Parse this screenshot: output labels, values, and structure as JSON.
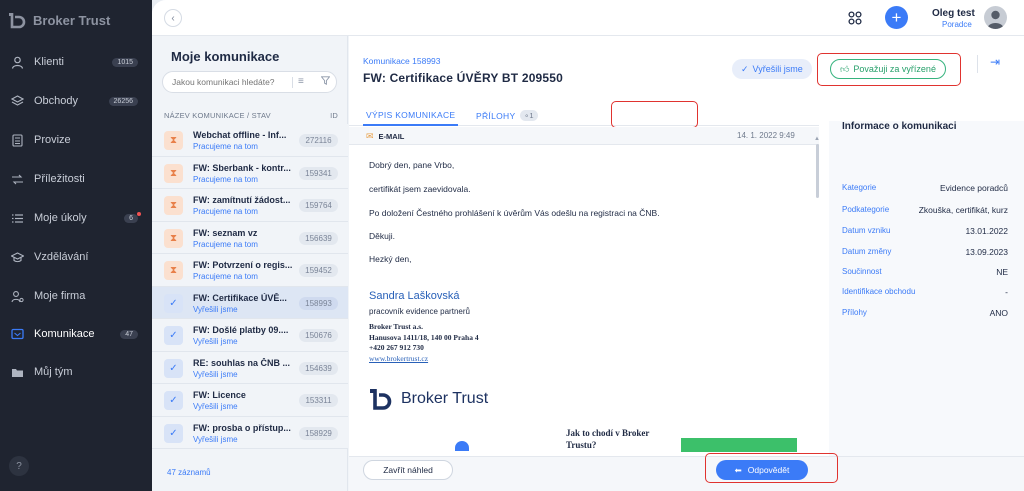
{
  "app": {
    "name": "Broker Trust"
  },
  "sidebar": {
    "items": [
      {
        "label": "Klienti",
        "badge": "1015",
        "icon": "person-icon"
      },
      {
        "label": "Obchody",
        "badge": "26256",
        "icon": "layers-icon"
      },
      {
        "label": "Provize",
        "badge": "",
        "icon": "calculator-icon"
      },
      {
        "label": "Příležitosti",
        "badge": "",
        "icon": "opportunity-icon"
      },
      {
        "label": "Moje úkoly",
        "badge": "6",
        "icon": "list-icon"
      },
      {
        "label": "Vzdělávání",
        "badge": "",
        "icon": "graduation-icon"
      },
      {
        "label": "Moje firma",
        "badge": "",
        "icon": "company-icon"
      },
      {
        "label": "Komunikace",
        "badge": "47",
        "icon": "chat-icon",
        "active": true
      },
      {
        "label": "Můj tým",
        "badge": "",
        "icon": "folder-icon"
      }
    ],
    "help_label": "?"
  },
  "topbar": {
    "user_name": "Oleg test",
    "user_role": "Poradce",
    "plus_label": "+"
  },
  "list": {
    "title": "Moje komunikace",
    "search_placeholder": "Jakou komunikaci hledáte?",
    "col_name": "NÁZEV KOMUNIKACE / STAV",
    "col_id": "ID",
    "rows": [
      {
        "title": "Webchat offline - Inf...",
        "status": "Pracujeme na tom",
        "id": "272116",
        "state": "pending"
      },
      {
        "title": "FW: Sberbank - kontr...",
        "status": "Pracujeme na tom",
        "id": "159341",
        "state": "pending"
      },
      {
        "title": "FW: zamítnutí žádost...",
        "status": "Pracujeme na tom",
        "id": "159764",
        "state": "pending"
      },
      {
        "title": "FW: seznam vz",
        "status": "Pracujeme na tom",
        "id": "156639",
        "state": "pending"
      },
      {
        "title": "FW: Potvrzení o regis...",
        "status": "Pracujeme na tom",
        "id": "159452",
        "state": "pending"
      },
      {
        "title": "FW: Certifikace ÚVĚ...",
        "status": "Vyřešili jsme",
        "id": "158993",
        "state": "done",
        "selected": true
      },
      {
        "title": "FW: Došlé platby 09....",
        "status": "Vyřešili jsme",
        "id": "150676",
        "state": "done"
      },
      {
        "title": "RE: souhlas na ČNB ...",
        "status": "Vyřešili jsme",
        "id": "154639",
        "state": "done"
      },
      {
        "title": "FW: Licence",
        "status": "Vyřešili jsme",
        "id": "153311",
        "state": "done"
      },
      {
        "title": "FW: prosba o přístup...",
        "status": "Vyřešili jsme",
        "id": "158929",
        "state": "done"
      }
    ],
    "count_label": "47 záznamů"
  },
  "detail": {
    "subtitle": "Komunikace 158993",
    "title": "FW: Certifikace ÚVĚRY BT 209550",
    "btn_resolved": "Vyřešili jsme",
    "btn_consider": "Považuji za vyřízené",
    "tabs": [
      {
        "label": "VÝPIS KOMUNIKACE"
      },
      {
        "label": "PŘÍLOHY",
        "count": "1"
      }
    ],
    "email": {
      "label": "E-MAIL",
      "date": "14. 1. 2022 9:49",
      "lines": [
        "Dobrý den, pane Vrbo,",
        "certifikát jsem zaevidovala.",
        "Po doložení Čestného prohlášení k úvěrům Vás odešlu na registraci na ČNB.",
        "Děkuji.",
        "Hezký den,"
      ],
      "sig_name": "Sandra Laškovská",
      "sig_role": "pracovník evidence partnerů",
      "sig_company": "Broker Trust a.s.",
      "sig_address": "Hanusova 1411/18, 140 00 Praha 4",
      "sig_phone": "+420 267 912 730",
      "sig_url": "www.brokertrust.cz",
      "logo_text": "Broker Trust",
      "promo_title": "Jak to chodí v Broker Trustu?"
    },
    "info": {
      "title": "Informace o komunikaci",
      "rows": [
        {
          "k": "Kategorie",
          "v": "Evidence poradců"
        },
        {
          "k": "Podkategorie",
          "v": "Zkouška, certifikát, kurz"
        },
        {
          "k": "Datum vzniku",
          "v": "13.01.2022"
        },
        {
          "k": "Datum změny",
          "v": "13.09.2023"
        },
        {
          "k": "Součinnost",
          "v": "NE"
        },
        {
          "k": "Identifikace obchodu",
          "v": "-"
        },
        {
          "k": "Přílohy",
          "v": "ANO"
        }
      ]
    },
    "btn_close": "Zavřít náhled",
    "btn_reply": "Odpovědět"
  },
  "colors": {
    "accent": "#3b7bf7",
    "sidebar": "#1f2430",
    "highlight": "#e0332f",
    "success": "#36b37e",
    "pending": "#e8804a"
  }
}
